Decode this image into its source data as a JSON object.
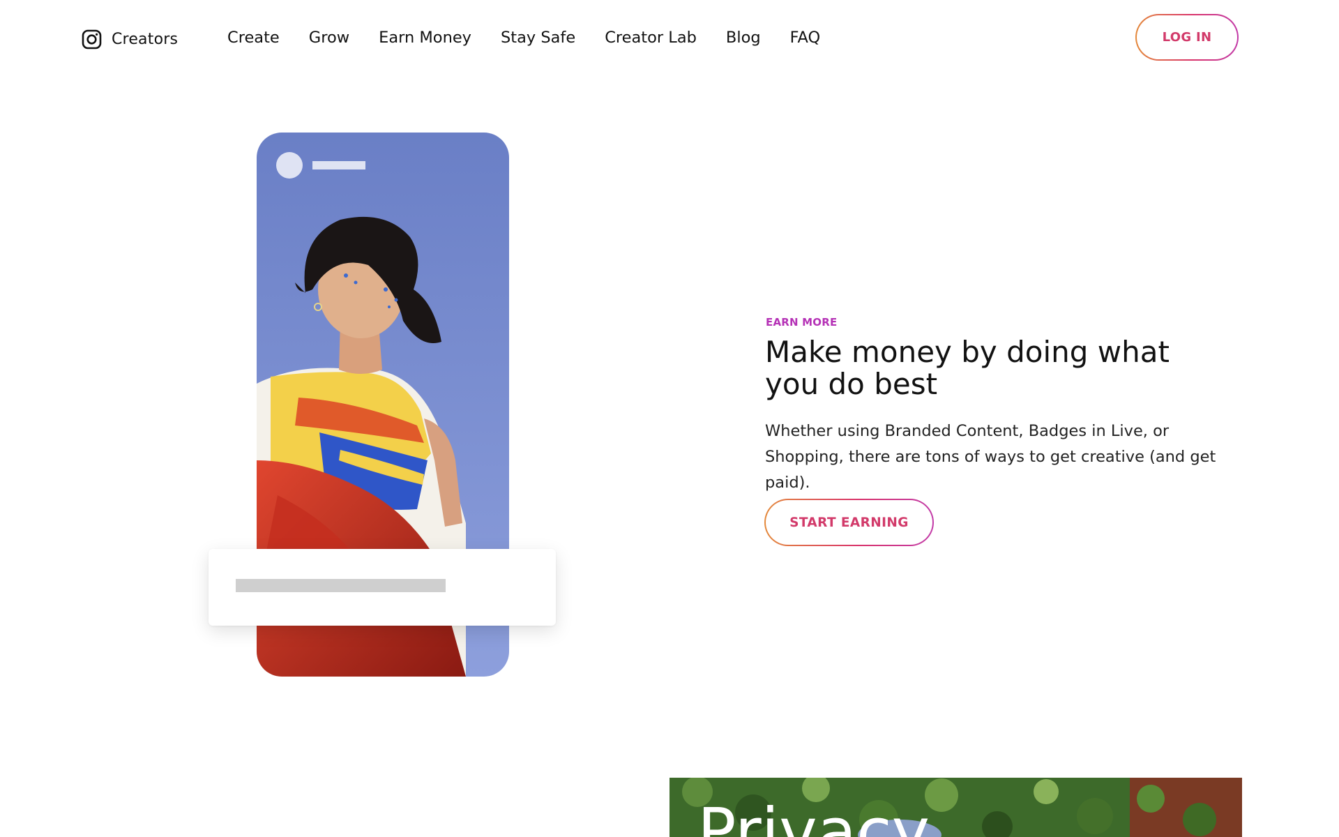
{
  "header": {
    "brand_icon": "instagram-icon",
    "brand_name": "Creators",
    "nav": [
      {
        "label": "Create"
      },
      {
        "label": "Grow"
      },
      {
        "label": "Earn Money"
      },
      {
        "label": "Stay Safe"
      },
      {
        "label": "Creator Lab"
      },
      {
        "label": "Blog"
      },
      {
        "label": "FAQ"
      }
    ],
    "login_label": "LOG IN"
  },
  "hero": {
    "eyebrow": "EARN MORE",
    "headline": "Make money by doing what you do best",
    "body": "Whether using Branded Content, Badges in Live, or Shopping, there are tons of ways to get creative (and get paid).",
    "cta_label": "START EARNING"
  },
  "next_section": {
    "title": "Privacy"
  },
  "colors": {
    "accent_text": "#d23a6a",
    "eyebrow": "#b532b6",
    "gradient_start": "#e4893a",
    "gradient_end": "#c23aa8"
  }
}
